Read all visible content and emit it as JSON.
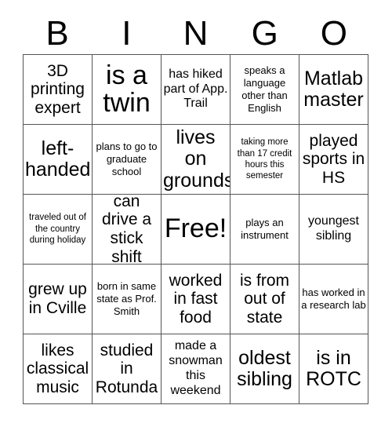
{
  "card": {
    "header_letters": [
      "B",
      "I",
      "N",
      "G",
      "O"
    ],
    "columns": 5,
    "rows": 5,
    "border_color": "#555555",
    "text_color": "#000000",
    "background_color": "#ffffff",
    "free_space_label": "Free!",
    "free_space_index": 12,
    "cells": [
      {
        "text": "3D printing expert"
      },
      {
        "text": "is a twin"
      },
      {
        "text": "has hiked part of App. Trail"
      },
      {
        "text": "speaks a language other than English"
      },
      {
        "text": "Matlab master"
      },
      {
        "text": "left-handed"
      },
      {
        "text": "plans to go to graduate school"
      },
      {
        "text": "lives on grounds"
      },
      {
        "text": "taking more than 17 credit hours this semester"
      },
      {
        "text": "played sports in HS"
      },
      {
        "text": "traveled out of the country during holiday"
      },
      {
        "text": "can drive a stick shift"
      },
      {
        "text": "Free!"
      },
      {
        "text": "plays an instrument"
      },
      {
        "text": "youngest sibling"
      },
      {
        "text": "grew up in Cville"
      },
      {
        "text": "born in same state as Prof. Smith"
      },
      {
        "text": "worked in fast food"
      },
      {
        "text": "is from out of state"
      },
      {
        "text": "has worked in a research lab"
      },
      {
        "text": "likes classical music"
      },
      {
        "text": "studied in Rotunda"
      },
      {
        "text": "made a snowman this weekend"
      },
      {
        "text": "oldest sibling"
      },
      {
        "text": "is in ROTC"
      }
    ]
  }
}
